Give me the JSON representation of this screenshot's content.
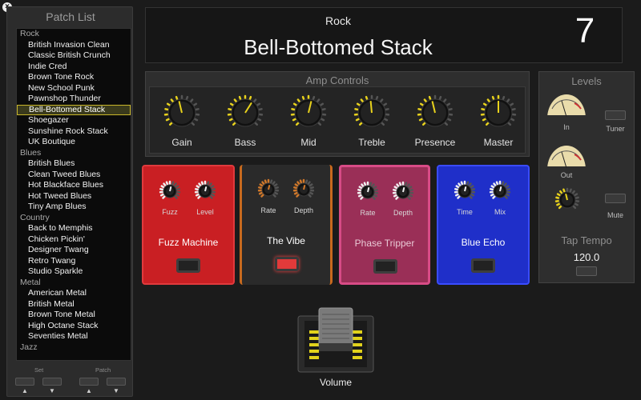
{
  "window": {
    "close_glyph": "×"
  },
  "patch_list": {
    "title": "Patch List",
    "rows": [
      {
        "type": "category",
        "label": "Rock"
      },
      {
        "type": "item",
        "label": "British Invasion Clean"
      },
      {
        "type": "item",
        "label": "Classic British Crunch"
      },
      {
        "type": "item",
        "label": "Indie Cred"
      },
      {
        "type": "item",
        "label": "Brown Tone Rock"
      },
      {
        "type": "item",
        "label": "New School Punk"
      },
      {
        "type": "item",
        "label": "Pawnshop Thunder"
      },
      {
        "type": "item",
        "label": "Bell-Bottomed Stack",
        "selected": true
      },
      {
        "type": "item",
        "label": "Shoegazer"
      },
      {
        "type": "item",
        "label": "Sunshine Rock Stack"
      },
      {
        "type": "item",
        "label": "UK Boutique"
      },
      {
        "type": "category",
        "label": "Blues"
      },
      {
        "type": "item",
        "label": "British Blues"
      },
      {
        "type": "item",
        "label": "Clean Tweed Blues"
      },
      {
        "type": "item",
        "label": "Hot Blackface Blues"
      },
      {
        "type": "item",
        "label": "Hot Tweed Blues"
      },
      {
        "type": "item",
        "label": "Tiny Amp Blues"
      },
      {
        "type": "category",
        "label": "Country"
      },
      {
        "type": "item",
        "label": "Back to Memphis"
      },
      {
        "type": "item",
        "label": "Chicken Pickin'"
      },
      {
        "type": "item",
        "label": "Designer Twang"
      },
      {
        "type": "item",
        "label": "Retro Twang"
      },
      {
        "type": "item",
        "label": "Studio Sparkle"
      },
      {
        "type": "category",
        "label": "Metal"
      },
      {
        "type": "item",
        "label": "American Metal"
      },
      {
        "type": "item",
        "label": "British Metal"
      },
      {
        "type": "item",
        "label": "Brown Tone Metal"
      },
      {
        "type": "item",
        "label": "High Octane Stack"
      },
      {
        "type": "item",
        "label": "Seventies Metal"
      },
      {
        "type": "category",
        "label": "Jazz"
      }
    ],
    "set_label": "Set",
    "patch_label": "Patch",
    "up_glyph": "▲",
    "down_glyph": "▼"
  },
  "header": {
    "category": "Rock",
    "patch_name": "Bell-Bottomed Stack",
    "patch_number": "7"
  },
  "amp_controls": {
    "title": "Amp Controls",
    "knobs": [
      {
        "label": "Gain",
        "level": 0.45
      },
      {
        "label": "Bass",
        "level": 0.62
      },
      {
        "label": "Mid",
        "level": 0.55
      },
      {
        "label": "Treble",
        "level": 0.48
      },
      {
        "label": "Presence",
        "level": 0.45
      },
      {
        "label": "Master",
        "level": 0.5
      }
    ],
    "accent_color": "#e8d21c"
  },
  "levels": {
    "title": "Levels",
    "in_label": "In",
    "out_label": "Out",
    "tuner_label": "Tuner",
    "mute_label": "Mute",
    "tap_tempo_label": "Tap Tempo",
    "tempo_value": "120.0",
    "level_knob": 0.45
  },
  "pedals": [
    {
      "name": "Fuzz Machine",
      "knobs": [
        "Fuzz",
        "Level"
      ],
      "color": "#c91f23",
      "on": false
    },
    {
      "name": "The Vibe",
      "knobs": [
        "Rate",
        "Depth"
      ],
      "color": "#2a2a2a",
      "on": true
    },
    {
      "name": "Phase Tripper",
      "knobs": [
        "Rate",
        "Depth"
      ],
      "color": "#b2345f",
      "on": false
    },
    {
      "name": "Blue Echo",
      "knobs": [
        "Time",
        "Mix"
      ],
      "color": "#1f2fc9",
      "on": false
    }
  ],
  "volume": {
    "label": "Volume"
  }
}
